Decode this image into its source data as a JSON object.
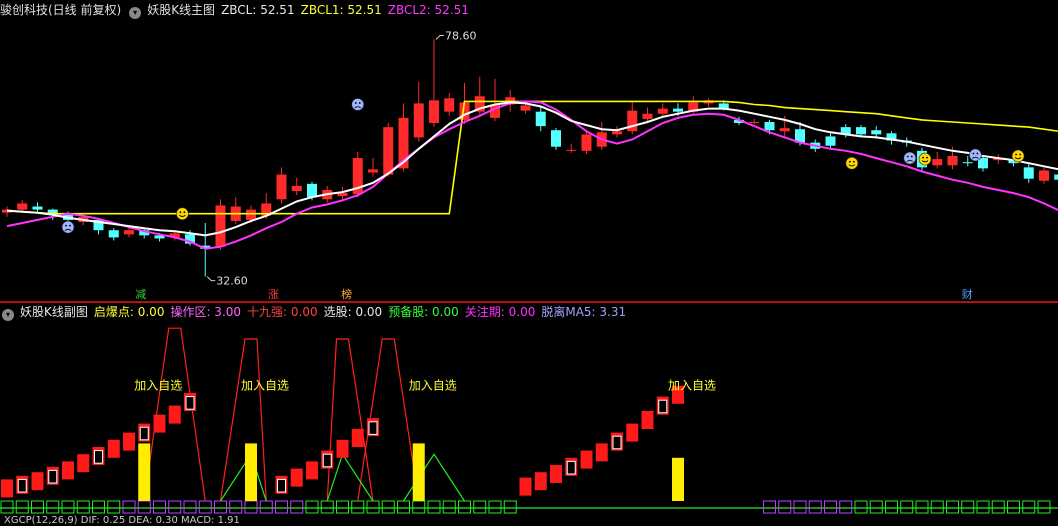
{
  "main_header": {
    "stock_name": "骏创科技(日线 前复权)",
    "chart_title": "妖股K线主图",
    "zbcl": "ZBCL: 52.51",
    "zbcl1": "ZBCL1: 52.51",
    "zbcl2": "ZBCL2: 52.51"
  },
  "sub_header": {
    "chart_title": "妖股K线副图",
    "qibaodian": "启爆点: 0.00",
    "caozuoqu": "操作区: 3.00",
    "shijiuqiang": "十九强: 0.00",
    "xuangu": "选股: 0.00",
    "yubeigu": "预备股: 0.00",
    "guanzhuqi": "关注期: 0.00",
    "tuoli": "脱离MA5: 3.31"
  },
  "bottom_header": {
    "text": "XGCP(12,26,9) DIF: 0.25 DEA: 0.30 MACD: 1.91"
  },
  "price_labels": {
    "high": "78.60",
    "low": "32.60"
  },
  "event_tags": [
    {
      "text": "减",
      "color": "#33cc33"
    },
    {
      "text": "涨",
      "color": "#ff4040"
    },
    {
      "text": "榜",
      "color": "#ffaa33"
    },
    {
      "text": "财",
      "color": "#4da6ff"
    }
  ],
  "add_watch_label": "加入自选",
  "colors": {
    "up": "#ff2a2a",
    "down": "#54ffff",
    "ma_white": "#ffffff",
    "ma_yellow": "#ffff00",
    "ma_magenta": "#ff33ff",
    "bar_yellow": "#ffee00",
    "green_line": "#22ee22"
  },
  "chart_data": {
    "type": "candlestick",
    "ylim": [
      30,
      82
    ],
    "candles": [
      [
        45.0,
        45.6,
        44.2,
        46.2
      ],
      [
        45.6,
        46.8,
        45.0,
        47.5
      ],
      [
        46.2,
        45.6,
        44.8,
        47.0
      ],
      [
        45.6,
        44.6,
        43.6,
        45.8
      ],
      [
        44.6,
        43.6,
        42.8,
        45.2
      ],
      [
        43.2,
        44.2,
        42.6,
        44.6
      ],
      [
        43.6,
        41.6,
        40.8,
        44.0
      ],
      [
        41.6,
        40.2,
        39.6,
        42.0
      ],
      [
        40.8,
        41.6,
        40.2,
        42.2
      ],
      [
        41.6,
        40.6,
        40.0,
        42.0
      ],
      [
        40.6,
        40.0,
        39.4,
        41.0
      ],
      [
        40.2,
        41.0,
        39.6,
        41.6
      ],
      [
        40.8,
        39.0,
        38.6,
        41.6
      ],
      [
        38.6,
        38.0,
        32.6,
        43.0
      ],
      [
        38.4,
        46.4,
        37.8,
        47.6
      ],
      [
        43.4,
        46.2,
        42.8,
        48.0
      ],
      [
        43.6,
        45.6,
        43.0,
        46.4
      ],
      [
        44.4,
        46.8,
        43.8,
        48.8
      ],
      [
        47.6,
        52.4,
        46.8,
        53.8
      ],
      [
        49.2,
        50.2,
        48.4,
        51.8
      ],
      [
        50.6,
        48.0,
        47.4,
        51.0
      ],
      [
        47.6,
        49.4,
        47.0,
        50.2
      ],
      [
        48.2,
        48.8,
        47.6,
        50.0
      ],
      [
        48.6,
        55.6,
        48.0,
        56.8
      ],
      [
        52.8,
        53.4,
        52.0,
        55.6
      ],
      [
        52.4,
        61.6,
        52.0,
        62.4
      ],
      [
        53.6,
        63.4,
        53.0,
        66.2
      ],
      [
        59.6,
        66.2,
        58.8,
        70.4
      ],
      [
        62.4,
        66.8,
        61.6,
        78.6
      ],
      [
        64.6,
        67.2,
        63.8,
        68.2
      ],
      [
        63.0,
        66.4,
        62.2,
        70.2
      ],
      [
        64.6,
        67.6,
        63.6,
        71.4
      ],
      [
        63.4,
        66.0,
        62.8,
        71.0
      ],
      [
        66.0,
        67.4,
        64.6,
        68.8
      ],
      [
        64.8,
        65.8,
        64.2,
        66.6
      ],
      [
        64.6,
        61.8,
        60.8,
        65.8
      ],
      [
        61.0,
        57.8,
        57.2,
        61.4
      ],
      [
        57.0,
        57.2,
        56.6,
        58.4
      ],
      [
        57.0,
        60.2,
        56.4,
        61.0
      ],
      [
        57.8,
        60.6,
        57.2,
        62.6
      ],
      [
        60.2,
        60.8,
        59.6,
        61.8
      ],
      [
        60.8,
        64.8,
        60.2,
        66.4
      ],
      [
        63.2,
        64.2,
        62.6,
        65.4
      ],
      [
        64.2,
        65.2,
        63.6,
        66.2
      ],
      [
        65.2,
        64.6,
        63.8,
        66.2
      ],
      [
        64.6,
        66.4,
        64.2,
        67.6
      ],
      [
        66.2,
        66.8,
        65.6,
        67.2
      ],
      [
        66.2,
        65.2,
        64.8,
        66.8
      ],
      [
        63.0,
        62.4,
        62.0,
        63.6
      ],
      [
        62.6,
        62.6,
        62.2,
        63.2
      ],
      [
        62.6,
        61.0,
        60.2,
        63.0
      ],
      [
        60.8,
        61.4,
        59.6,
        63.8
      ],
      [
        61.2,
        58.6,
        58.0,
        62.6
      ],
      [
        58.6,
        57.4,
        56.8,
        59.2
      ],
      [
        59.8,
        58.0,
        57.2,
        60.8
      ],
      [
        61.6,
        60.2,
        59.6,
        62.2
      ],
      [
        61.6,
        60.2,
        59.8,
        62.0
      ],
      [
        61.0,
        60.2,
        59.4,
        61.8
      ],
      [
        60.4,
        59.0,
        58.2,
        60.8
      ],
      [
        59.0,
        58.6,
        57.8,
        59.6
      ],
      [
        57.0,
        53.8,
        53.2,
        57.6
      ],
      [
        54.2,
        55.4,
        53.6,
        56.8
      ],
      [
        54.2,
        56.0,
        53.4,
        57.8
      ],
      [
        54.8,
        54.6,
        54.0,
        56.0
      ],
      [
        55.6,
        53.6,
        53.0,
        56.2
      ],
      [
        55.2,
        55.6,
        54.4,
        56.4
      ],
      [
        55.4,
        54.6,
        54.0,
        55.8
      ],
      [
        53.8,
        51.6,
        50.8,
        54.6
      ],
      [
        51.2,
        53.2,
        50.6,
        53.8
      ],
      [
        52.4,
        51.4,
        50.6,
        53.0
      ],
      [
        52.2,
        51.8,
        51.2,
        52.6
      ],
      [
        52.4,
        51.6,
        51.0,
        53.0
      ],
      [
        47.6,
        40.4,
        38.8,
        48.2
      ],
      [
        39.6,
        42.8,
        39.0,
        43.6
      ],
      [
        41.2,
        47.8,
        40.6,
        48.2
      ],
      [
        50.2,
        52.6,
        49.8,
        55.4
      ],
      [
        52.0,
        53.2,
        51.4,
        54.6
      ],
      [
        52.8,
        53.8,
        52.2,
        54.8
      ],
      [
        53.6,
        54.0,
        53.0,
        54.4
      ],
      [
        54.2,
        54.2,
        53.6,
        54.8
      ],
      [
        53.0,
        55.0,
        52.4,
        56.6
      ],
      [
        54.6,
        53.4,
        52.8,
        55.2
      ],
      [
        54.2,
        54.6,
        53.6,
        55.2
      ],
      [
        54.4,
        56.2,
        53.8,
        58.2
      ],
      [
        52.4,
        52.8,
        52.0,
        53.6
      ],
      [
        53.8,
        53.6,
        53.2,
        55.0
      ],
      [
        55.4,
        54.0,
        53.6,
        56.8
      ],
      [
        53.4,
        56.2,
        52.8,
        57.0
      ],
      [
        56.2,
        55.4,
        54.8,
        57.6
      ],
      [
        57.4,
        56.6,
        56.0,
        58.6
      ],
      [
        57.0,
        57.4,
        56.8,
        60.6
      ],
      [
        57.6,
        58.2,
        57.2,
        59.0
      ],
      [
        57.6,
        58.0,
        57.2,
        58.4
      ],
      [
        58.4,
        58.4,
        58.0,
        58.8
      ],
      [
        57.4,
        57.8,
        57.0,
        58.2
      ],
      [
        57.2,
        57.0,
        56.8,
        57.6
      ],
      [
        57.0,
        56.8,
        56.4,
        57.6
      ],
      [
        57.2,
        56.6,
        56.2,
        57.4
      ],
      [
        57.6,
        57.2,
        56.8,
        58.0
      ],
      [
        55.8,
        57.6,
        55.4,
        58.4
      ],
      [
        57.2,
        58.0,
        56.4,
        59.2
      ],
      [
        58.4,
        59.2,
        57.8,
        59.8
      ],
      [
        58.8,
        59.6,
        58.2,
        60.2
      ],
      [
        59.6,
        58.2,
        57.8,
        60.0
      ],
      [
        59.8,
        61.2,
        59.4,
        62.4
      ]
    ],
    "ma_white": [
      45.4,
      45.2,
      45.0,
      44.6,
      44.0,
      43.6,
      43.2,
      42.8,
      42.4,
      42.0,
      41.6,
      41.4,
      41.0,
      40.6,
      41.2,
      42.2,
      43.4,
      44.4,
      45.8,
      47.2,
      48.0,
      48.6,
      49.0,
      49.8,
      50.8,
      52.6,
      54.8,
      57.4,
      59.8,
      62.2,
      64.0,
      65.2,
      66.0,
      66.4,
      66.2,
      65.6,
      64.4,
      62.8,
      62.0,
      61.2,
      61.0,
      61.8,
      62.6,
      63.6,
      64.2,
      64.8,
      65.2,
      65.2,
      64.8,
      64.2,
      63.6,
      63.0,
      62.2,
      61.2,
      60.6,
      60.2,
      59.8,
      59.6,
      59.2,
      58.8,
      58.2,
      57.6,
      57.0,
      56.6,
      56.0,
      55.6,
      55.2,
      54.6,
      54.0,
      53.4,
      52.8,
      52.2,
      51.2,
      49.8,
      48.4,
      47.8,
      47.8,
      48.4,
      49.4,
      50.6,
      51.6,
      52.4,
      53.0,
      53.6,
      54.0,
      54.4,
      54.8,
      55.2,
      55.4,
      55.6,
      55.8,
      56.0,
      56.2,
      56.4,
      56.6,
      56.8,
      57.0,
      57.2,
      57.4,
      57.6,
      57.8,
      58.0,
      58.2,
      58.6,
      59.0
    ],
    "ma_yellow": [
      45.4,
      45.2,
      45.0,
      44.8,
      44.8,
      44.8,
      44.8,
      44.8,
      44.8,
      44.8,
      44.8,
      44.8,
      44.8,
      44.8,
      44.8,
      44.8,
      44.8,
      44.8,
      44.8,
      44.8,
      44.8,
      44.8,
      44.8,
      44.8,
      44.8,
      44.8,
      44.8,
      44.8,
      44.8,
      44.8,
      66.6,
      66.6,
      66.6,
      66.6,
      66.6,
      66.6,
      66.6,
      66.6,
      66.6,
      66.6,
      66.6,
      66.6,
      66.6,
      66.6,
      66.6,
      66.6,
      66.6,
      66.6,
      66.4,
      66.0,
      65.8,
      65.4,
      65.2,
      65.0,
      64.8,
      64.6,
      64.4,
      64.2,
      63.8,
      63.4,
      63.0,
      62.8,
      62.6,
      62.4,
      62.2,
      62.0,
      61.8,
      61.6,
      61.2,
      60.8,
      60.4,
      60.0,
      59.6,
      59.0,
      58.4,
      57.8,
      57.4,
      57.0,
      56.8,
      56.6,
      56.4,
      56.2,
      56.0,
      55.6,
      55.6,
      55.6,
      55.6,
      55.6,
      55.6,
      55.6,
      55.6,
      55.6,
      55.6,
      55.6,
      55.6,
      55.6,
      55.6,
      55.6,
      55.6,
      55.6,
      55.6,
      55.6,
      55.6,
      55.6,
      55.6
    ],
    "ma_magenta": [
      42.4,
      43.0,
      43.6,
      44.2,
      44.8,
      44.4,
      43.8,
      43.0,
      42.2,
      41.4,
      40.8,
      40.2,
      39.4,
      38.0,
      38.4,
      39.4,
      40.6,
      42.0,
      43.2,
      44.8,
      46.0,
      46.6,
      47.4,
      48.4,
      50.0,
      52.6,
      55.2,
      57.4,
      59.6,
      61.2,
      62.6,
      63.8,
      65.2,
      66.2,
      66.6,
      66.4,
      65.0,
      63.0,
      60.8,
      59.2,
      58.4,
      59.2,
      60.8,
      62.4,
      63.4,
      64.0,
      64.2,
      64.0,
      63.0,
      61.8,
      60.6,
      59.6,
      58.6,
      58.0,
      57.4,
      57.0,
      56.4,
      55.6,
      54.8,
      54.0,
      53.0,
      52.2,
      51.4,
      50.8,
      50.0,
      49.4,
      48.8,
      48.0,
      46.8,
      45.4,
      44.0,
      42.6,
      40.8,
      38.8,
      37.2,
      36.2,
      35.8,
      35.6,
      35.8,
      38.0,
      42.4,
      47.2,
      51.6,
      53.6,
      54.6,
      55.0,
      55.4,
      55.8,
      56.0,
      56.4,
      56.8,
      57.0,
      57.0,
      57.0,
      57.0,
      57.2,
      57.4,
      57.6,
      57.8,
      58.0,
      58.2,
      58.4,
      58.6,
      58.8,
      59.0
    ],
    "sub": {
      "ylim": [
        0,
        100
      ],
      "red_boxes": [
        [
          0,
          2
        ],
        [
          1,
          4
        ],
        [
          2,
          6
        ],
        [
          3,
          9
        ],
        [
          4,
          12
        ],
        [
          5,
          16
        ],
        [
          6,
          20
        ],
        [
          7,
          24
        ],
        [
          8,
          28
        ],
        [
          9,
          33
        ],
        [
          10,
          38
        ],
        [
          11,
          43
        ],
        [
          12,
          50
        ],
        [
          18,
          4
        ],
        [
          19,
          8
        ],
        [
          20,
          12
        ],
        [
          21,
          18
        ],
        [
          22,
          24
        ],
        [
          23,
          30
        ],
        [
          24,
          36
        ],
        [
          34,
          3
        ],
        [
          35,
          6
        ],
        [
          36,
          10
        ],
        [
          37,
          14
        ],
        [
          38,
          18
        ],
        [
          39,
          22
        ],
        [
          40,
          28
        ],
        [
          41,
          33
        ],
        [
          42,
          40
        ],
        [
          43,
          48
        ],
        [
          44,
          54
        ],
        [
          76,
          4
        ],
        [
          77,
          8
        ],
        [
          78,
          12
        ],
        [
          79,
          18
        ],
        [
          80,
          24
        ],
        [
          81,
          30
        ],
        [
          82,
          36
        ],
        [
          83,
          42
        ],
        [
          84,
          48
        ],
        [
          85,
          54
        ]
      ],
      "hollow_boxes": [
        [
          1,
          4
        ],
        [
          3,
          9
        ],
        [
          6,
          20
        ],
        [
          9,
          33
        ],
        [
          12,
          50
        ],
        [
          18,
          4
        ],
        [
          21,
          18
        ],
        [
          24,
          36
        ],
        [
          37,
          14
        ],
        [
          40,
          28
        ],
        [
          43,
          48
        ],
        [
          80,
          24
        ],
        [
          83,
          42
        ]
      ],
      "yellow_bars": [
        [
          9,
          32
        ],
        [
          16,
          32
        ],
        [
          27,
          32
        ],
        [
          44,
          24
        ],
        [
          78,
          32
        ],
        [
          84,
          32
        ],
        [
          90,
          32
        ],
        [
          99,
          32
        ]
      ],
      "add_watch_at": [
        9,
        16,
        27,
        44,
        78,
        84,
        90,
        99
      ],
      "red_spikes": [
        [
          9,
          11,
          13,
          96
        ],
        [
          14,
          16,
          17,
          90
        ],
        [
          21,
          22,
          24,
          90
        ],
        [
          23,
          25,
          27,
          90
        ],
        [
          76,
          77,
          79,
          96
        ]
      ],
      "green_spikes": [
        [
          14,
          16,
          17,
          26
        ],
        [
          21,
          22,
          24,
          26
        ],
        [
          26,
          28,
          30,
          26
        ]
      ]
    }
  }
}
